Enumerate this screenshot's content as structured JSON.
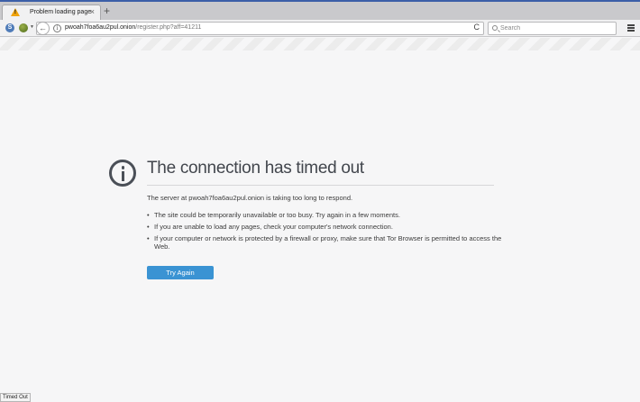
{
  "tabs": [
    {
      "label": "Problem loading page",
      "close": "×"
    }
  ],
  "tabstrip": {
    "new_tab": "+"
  },
  "navbar": {
    "onion_glyph": "S",
    "back_glyph": "←",
    "info_glyph": "i",
    "url_host": "pwoah7foa6au2pul.onion",
    "url_path": "/register.php?aff=41211",
    "reload_glyph": "C",
    "search_placeholder": "Search"
  },
  "error": {
    "title": "The connection has timed out",
    "description": "The server at pwoah7foa6au2pul.onion is taking too long to respond.",
    "suggestions": [
      "The site could be temporarily unavailable or too busy. Try again in a few moments.",
      "If you are unable to load any pages, check your computer's network connection.",
      "If your computer or network is protected by a firewall or proxy, make sure that Tor Browser is permitted to access the Web."
    ],
    "button_label": "Try Again"
  },
  "statusbar": {
    "text": "Timed Out"
  },
  "colors": {
    "accent": "#3a93d3",
    "warning": "#f0a30a",
    "icon": "#4a4f57"
  }
}
